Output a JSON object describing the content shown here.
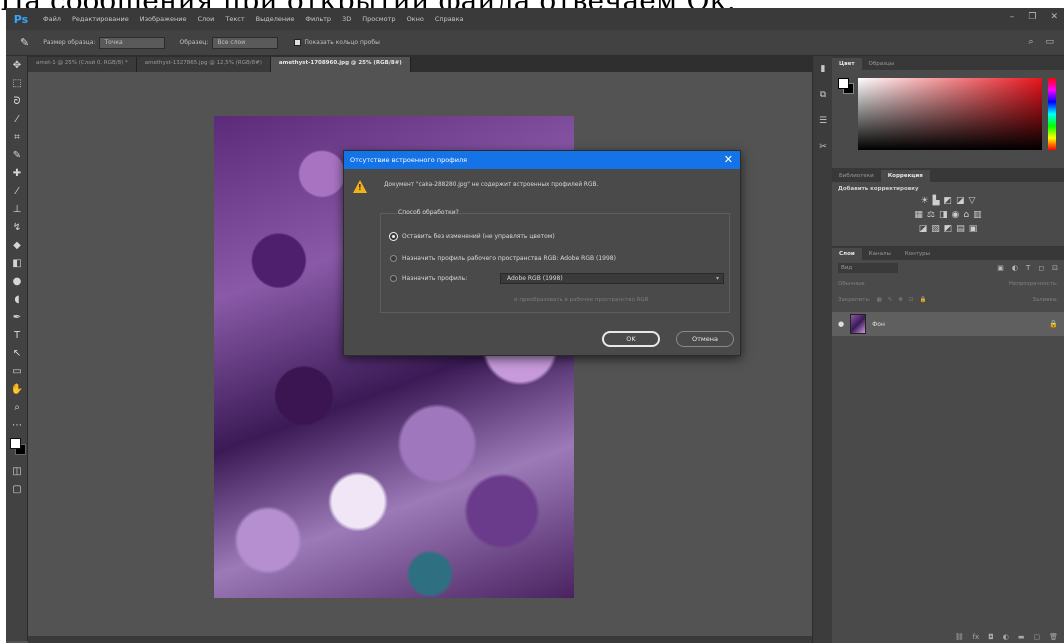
{
  "caption": "На сообщения при открытии файла отвечаем Ок.",
  "app": {
    "logo": "Ps",
    "menu": [
      "Файл",
      "Редактирование",
      "Изображение",
      "Слои",
      "Текст",
      "Выделение",
      "Фильтр",
      "3D",
      "Просмотр",
      "Окно",
      "Справка"
    ],
    "window_controls": [
      "–",
      "❐",
      "✕"
    ]
  },
  "options": {
    "sample_size_label": "Размер образца:",
    "sample_size_value": "Точка",
    "sample_label": "Образец:",
    "sample_value": "Все слои",
    "show_ring_label": "Показать кольцо пробы"
  },
  "tabs": [
    {
      "label": "amet-1 @ 25% (Слой 0, RGB/8) *",
      "active": false
    },
    {
      "label": "amethyst-1327865.jpg @ 12,5% (RGB/8#)",
      "active": false
    },
    {
      "label": "amethyst-1708960.jpg @ 25% (RGB/8#)",
      "active": true
    }
  ],
  "dialog": {
    "title": "Отсутствие встроенного профиля",
    "message": "Документ \"caka-288280.jpg\" не содержит встроенных профилей RGB.",
    "group_label": "Способ обработки?",
    "options": [
      "Оставить без изменений (не управлять цветом)",
      "Назначить профиль рабочего пространства RGB: Adobe RGB (1998)",
      "Назначить профиль:"
    ],
    "selected_option": 0,
    "profile_value": "Adobe RGB (1998)",
    "convert_label": "и преобразовать в рабочее пространство RGB",
    "ok": "OK",
    "cancel": "Отмена"
  },
  "panels": {
    "color_tabs": [
      "Цвет",
      "Образцы"
    ],
    "adj_tabs": [
      "Библиотеки",
      "Коррекция"
    ],
    "adj_title": "Добавить корректировку",
    "layers_tabs": [
      "Слои",
      "Каналы",
      "Контуры"
    ],
    "search_placeholder": "Вид",
    "blend_mode": "Обычные",
    "opacity_label": "Непрозрачность:",
    "lock_label": "Закрепить:",
    "fill_label": "Заливка:",
    "layer_name": "Фон"
  },
  "colors": {
    "ps_accent": "#31a8ff",
    "dialog_title_bg": "#1473e6",
    "warning": "#f2b21c"
  }
}
